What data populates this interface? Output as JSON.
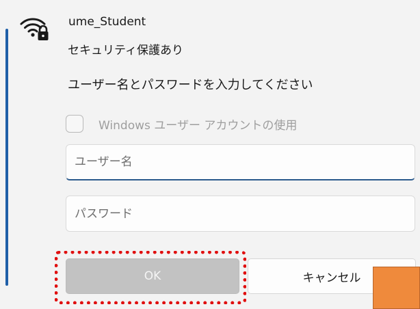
{
  "network": {
    "name": "ume_Student",
    "security_status": "セキュリティ保護あり",
    "icon": "wifi-secured-icon"
  },
  "credentials_prompt": {
    "instruction": "ユーザー名とパスワードを入力してください",
    "use_windows_account_label": "Windows ユーザー アカウントの使用",
    "use_windows_account_checked": false,
    "username_placeholder": "ユーザー名",
    "username_value": "",
    "password_placeholder": "パスワード",
    "password_value": ""
  },
  "actions": {
    "ok_label": "OK",
    "ok_enabled": false,
    "cancel_label": "キャンセル"
  },
  "colors": {
    "selection_accent": "#1f5fa8",
    "highlight_ring": "#e01010",
    "orange_marker": "#ef8a3c"
  }
}
